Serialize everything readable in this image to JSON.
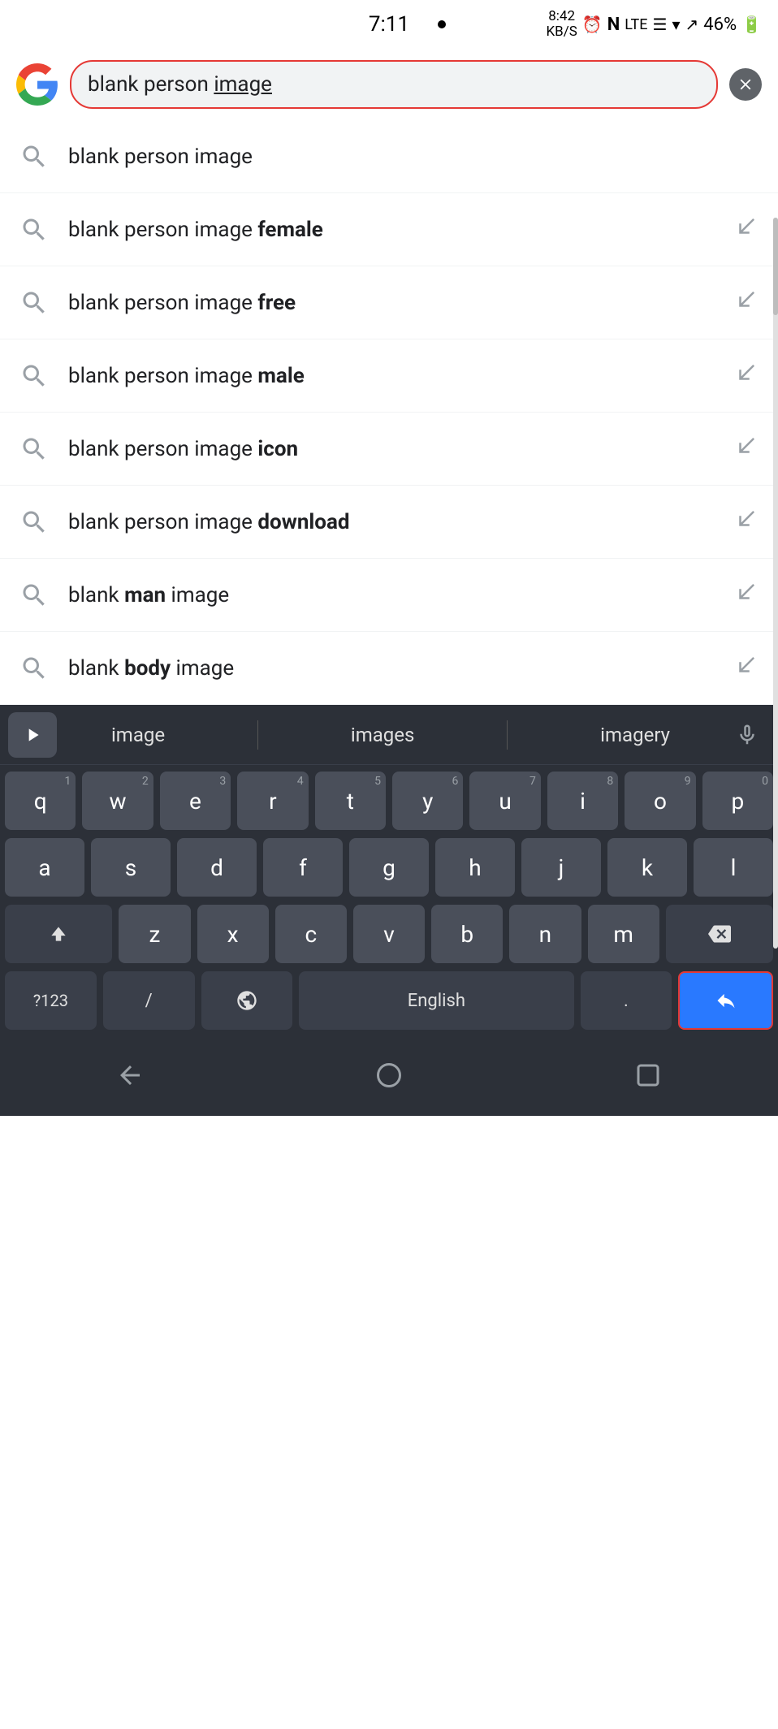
{
  "statusBar": {
    "time": "7:11",
    "battery": "46%",
    "kbLabel": "8:42\nKB/S"
  },
  "searchBar": {
    "query": "blank person image",
    "queryPrefix": "blank person ",
    "querySuffix": "image",
    "clearLabel": "clear"
  },
  "suggestions": [
    {
      "id": 1,
      "prefix": "blank person image",
      "bold": "",
      "hasArrow": false
    },
    {
      "id": 2,
      "prefix": "blank person image ",
      "bold": "female",
      "hasArrow": true
    },
    {
      "id": 3,
      "prefix": "blank person image ",
      "bold": "free",
      "hasArrow": true
    },
    {
      "id": 4,
      "prefix": "blank person image ",
      "bold": "male",
      "hasArrow": true
    },
    {
      "id": 5,
      "prefix": "blank person image ",
      "bold": "icon",
      "hasArrow": true
    },
    {
      "id": 6,
      "prefix": "blank person image ",
      "bold": "download",
      "hasArrow": true
    },
    {
      "id": 7,
      "prefix": "blank ",
      "bold": "man",
      "suffix": " image",
      "hasArrow": true
    },
    {
      "id": 8,
      "prefix": "blank ",
      "bold": "body",
      "suffix": " image",
      "hasArrow": true
    }
  ],
  "keyboard": {
    "suggestions": [
      "image",
      "images",
      "imagery"
    ],
    "rows": [
      [
        "q",
        "w",
        "e",
        "r",
        "t",
        "y",
        "u",
        "i",
        "o",
        "p"
      ],
      [
        "a",
        "s",
        "d",
        "f",
        "g",
        "h",
        "j",
        "k",
        "l"
      ],
      [
        "z",
        "x",
        "c",
        "v",
        "b",
        "n",
        "m"
      ],
      [
        "?123",
        "/",
        "globe",
        "English",
        ".",
        "enter"
      ]
    ],
    "numHints": [
      "1",
      "2",
      "3",
      "4",
      "5",
      "6",
      "7",
      "8",
      "9",
      "0"
    ]
  },
  "navbar": {
    "back": "▽",
    "home": "○",
    "recents": "□"
  }
}
